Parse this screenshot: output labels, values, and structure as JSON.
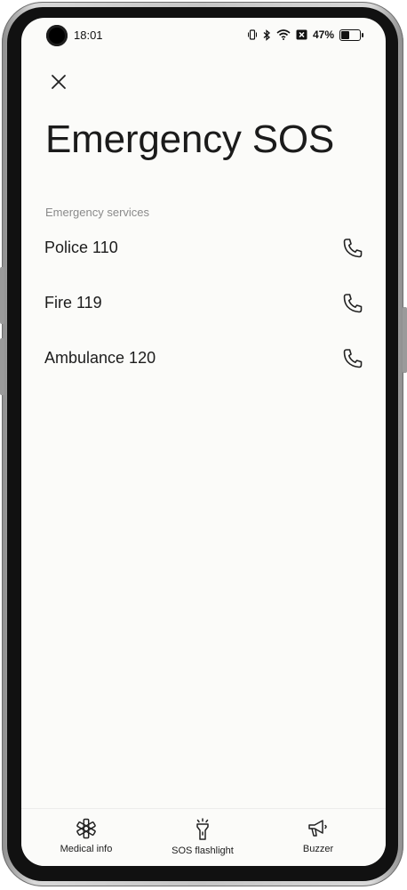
{
  "status_bar": {
    "time": "18:01",
    "battery_text": "47%",
    "battery_level": 0.47,
    "icons": [
      "vibrate-icon",
      "bluetooth-icon",
      "wifi-icon",
      "x-badge-icon",
      "battery-icon"
    ]
  },
  "header": {
    "close_icon": "close-icon",
    "title": "Emergency SOS"
  },
  "services": {
    "section_label": "Emergency services",
    "items": [
      {
        "label": "Police 110",
        "icon": "phone-icon"
      },
      {
        "label": "Fire 119",
        "icon": "phone-icon"
      },
      {
        "label": "Ambulance 120",
        "icon": "phone-icon"
      }
    ]
  },
  "bottom_bar": {
    "items": [
      {
        "label": "Medical info",
        "icon": "medical-asterisk-icon"
      },
      {
        "label": "SOS flashlight",
        "icon": "flashlight-icon"
      },
      {
        "label": "Buzzer",
        "icon": "megaphone-icon"
      }
    ]
  }
}
